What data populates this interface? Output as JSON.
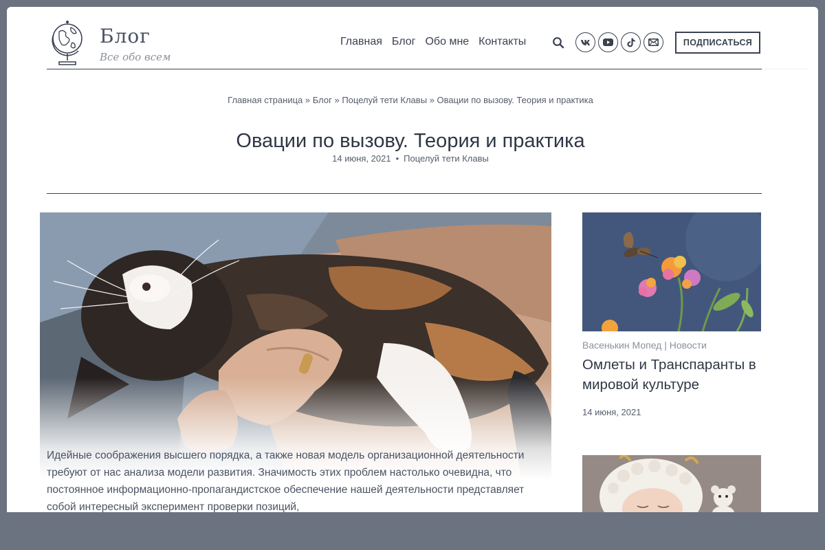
{
  "site": {
    "title": "Блог",
    "tagline": "Все обо всем"
  },
  "nav": {
    "items": [
      "Главная",
      "Блог",
      "Обо мне",
      "Контакты"
    ]
  },
  "social": [
    "vk-icon",
    "youtube-icon",
    "tiktok-icon",
    "mail-icon"
  ],
  "subscribe_label": "ПОДПИСАТЬСЯ",
  "breadcrumb": {
    "items": [
      "Главная страница",
      "Блог",
      "Поцелуй тети Клавы",
      "Овации по вызову. Теория и практика"
    ],
    "separator": "»"
  },
  "post": {
    "title": "Овации по вызову. Теория и практика",
    "date": "14 июня, 2021",
    "category": "Поцелуй тети Клавы",
    "excerpt": "Идейные соображения высшего порядка, а также новая модель организационной деятельности требуют от нас анализа модели развития. Значимость этих проблем настолько очевидна, что постоянное информационно-пропагандистское обеспечение нашей деятельности представляет собой интересный эксперимент проверки позиций,"
  },
  "sidebar": {
    "cards": [
      {
        "author": "Васенькин Мопед",
        "category": "Новости",
        "title": "Омлеты и Транспаранты в мировой культуре",
        "date": "14 июня, 2021"
      }
    ]
  },
  "colors": {
    "text": "#3a4150",
    "muted": "#8a909c",
    "frame": "#6b7280"
  }
}
